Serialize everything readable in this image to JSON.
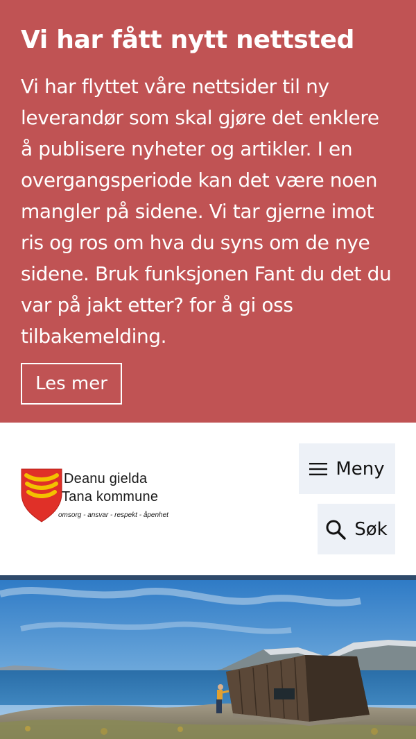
{
  "notice": {
    "title": "Vi har fått nytt nettsted",
    "body": "Vi har flyttet våre nettsider til ny leverandør som skal gjøre det enklere å publisere nyheter og artikler. I en overgangsperiode kan det være noen mangler på sidene. Vi tar gjerne imot ris og ros om hva du syns om de nye sidene. Bruk funksjonen Fant du det du var på jakt etter? for å gi oss tilbakemelding.",
    "button": "Les mer"
  },
  "header": {
    "logo": {
      "line1": "Deanu gielda",
      "line2": "Tana kommune",
      "motto": "omsorg - ansvar - respekt - åpenhet"
    },
    "menu_label": "Meny",
    "search_label": "Søk",
    "menu_icon": "hamburger-icon",
    "search_icon": "search-icon"
  },
  "colors": {
    "notice_bg": "#c05354",
    "button_bg": "#edf1f7",
    "rule": "#2e4a6b"
  }
}
